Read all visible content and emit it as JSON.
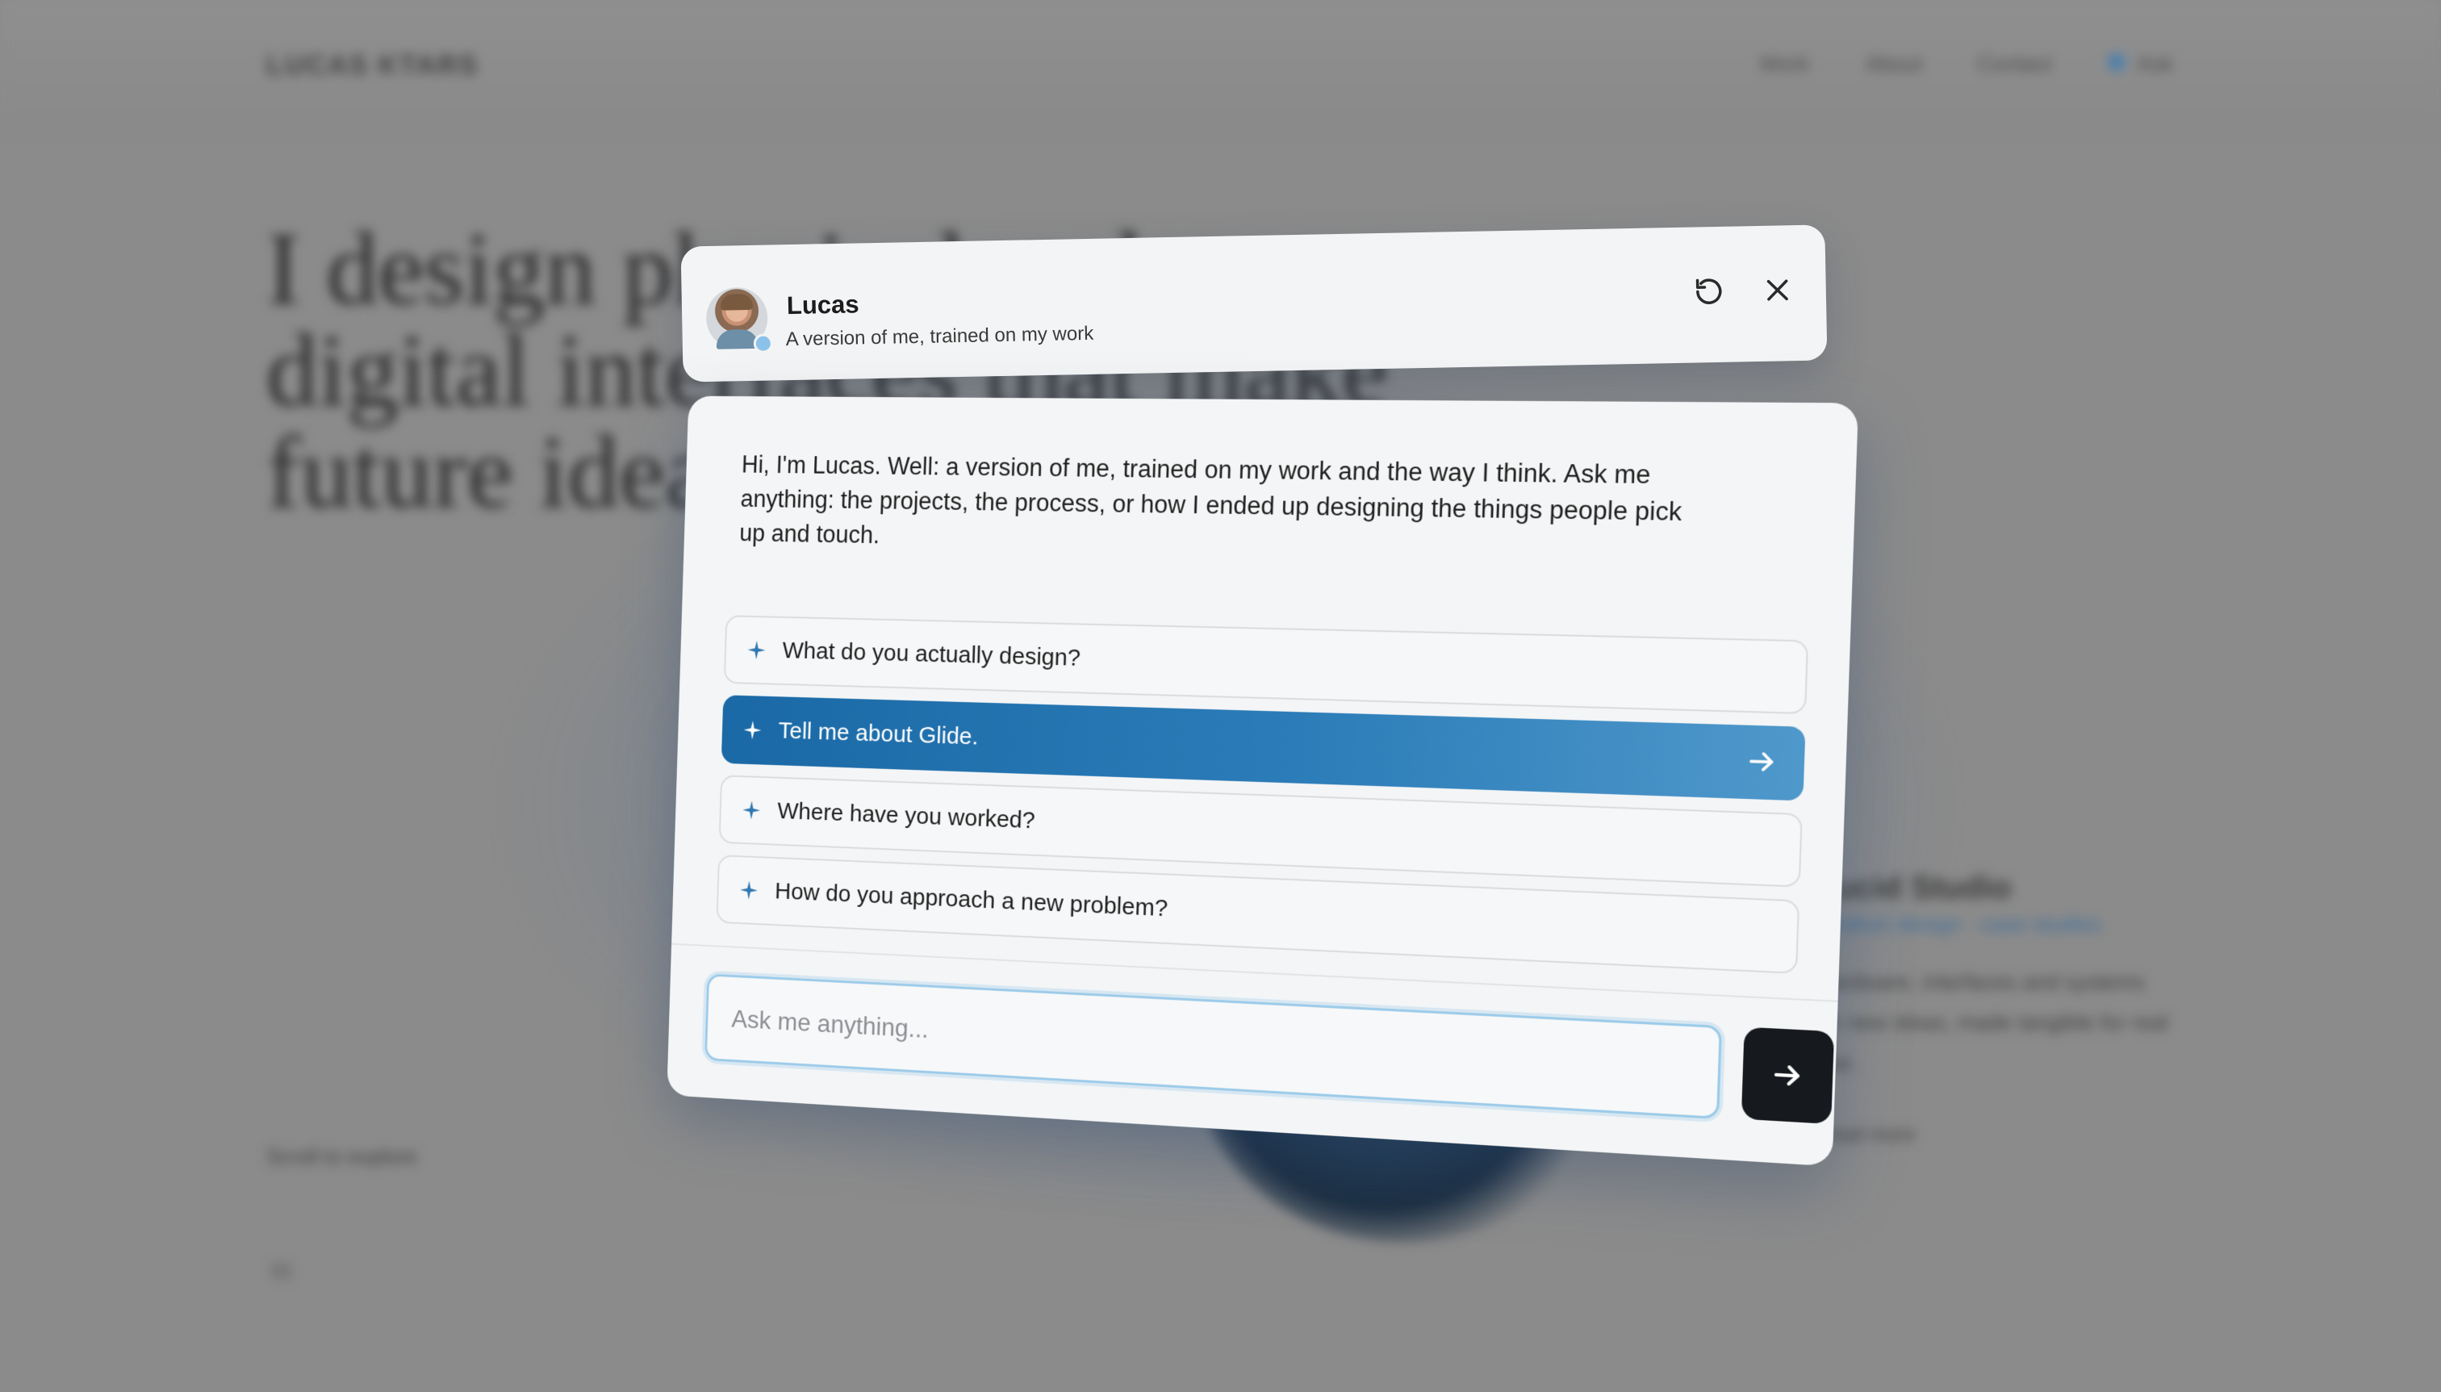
{
  "background": {
    "logo": "LUCAS KTARS",
    "nav": [
      "Work",
      "About",
      "Contact",
      "Ask"
    ],
    "headline": "I design physical and digital interfaces that make future ideas exp",
    "card_title": "Lucid Studio",
    "card_link": "Product design · case studies",
    "card_body": "Hardware, interfaces and systems for new ideas, made tangible for real use.",
    "card_more": "Read more",
    "scroll_hint": "Scroll to explore",
    "small_mark": "01"
  },
  "chat": {
    "name": "Lucas",
    "subtitle": "A version of me, trained on my work",
    "reset_icon": "reset-icon",
    "close_icon": "close-icon",
    "intro": "Hi, I'm Lucas. Well: a version of me, trained on my work and the way I think. Ask me anything: the projects, the process, or how I ended up designing the things people pick up and touch.",
    "suggestions": [
      {
        "label": "What do you actually design?",
        "icon": "sparkle-icon"
      },
      {
        "label": "Tell me about Glide.",
        "icon": "sparkle-icon",
        "active": true
      },
      {
        "label": "Where have you worked?",
        "icon": "sparkle-icon"
      },
      {
        "label": "How do you approach a new problem?",
        "icon": "sparkle-icon"
      }
    ],
    "input_placeholder": "Ask me anything...",
    "send_icon": "arrow-right-icon",
    "accent": "#1f6fad",
    "accent_light": "#4f98cb",
    "send_button_color": "#161a1e"
  }
}
